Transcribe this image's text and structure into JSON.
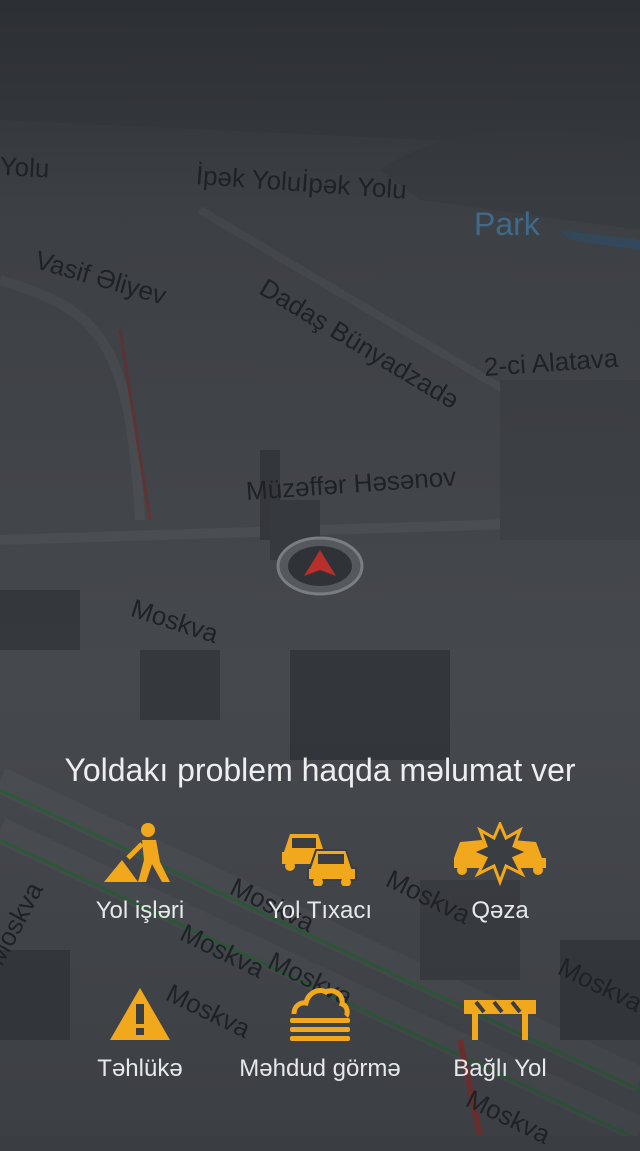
{
  "map": {
    "streets": [
      {
        "label": "İpək Yolu",
        "cls": "s1"
      },
      {
        "label": "İpək Yoluİpək Yolu",
        "cls": "s2"
      },
      {
        "label": "Vasif Əliyev",
        "cls": "s3"
      },
      {
        "label": "Dadaş Bünyadzadə",
        "cls": "s4"
      },
      {
        "label": "2-ci Alatava",
        "cls": "s5"
      },
      {
        "label": "Müzəffər Həsənov",
        "cls": "s6"
      },
      {
        "label": "Moskva",
        "cls": "s7"
      },
      {
        "label": "Moskva",
        "cls": "s8"
      },
      {
        "label": "Moskva",
        "cls": "s9"
      },
      {
        "label": "Moskva",
        "cls": "s10"
      },
      {
        "label": "Moskva",
        "cls": "s11"
      },
      {
        "label": "Moskva",
        "cls": "s12"
      },
      {
        "label": "Moskva",
        "cls": "s13"
      },
      {
        "label": "Moskva",
        "cls": "s14"
      },
      {
        "label": "Moskva",
        "cls": "s15"
      }
    ],
    "park_label": "Park"
  },
  "report": {
    "title": "Yoldakı problem haqda məlumat ver",
    "options": [
      {
        "label": "Yol işləri",
        "icon": "road-works-icon"
      },
      {
        "label": "Yol Tıxacı",
        "icon": "traffic-jam-icon"
      },
      {
        "label": "Qəza",
        "icon": "accident-icon"
      },
      {
        "label": "Təhlükə",
        "icon": "hazard-icon"
      },
      {
        "label": "Məhdud görmə",
        "icon": "fog-icon"
      },
      {
        "label": "Bağlı Yol",
        "icon": "road-closed-icon"
      }
    ]
  },
  "colors": {
    "accent": "#f2a81d",
    "text": "#e6e8ea"
  }
}
